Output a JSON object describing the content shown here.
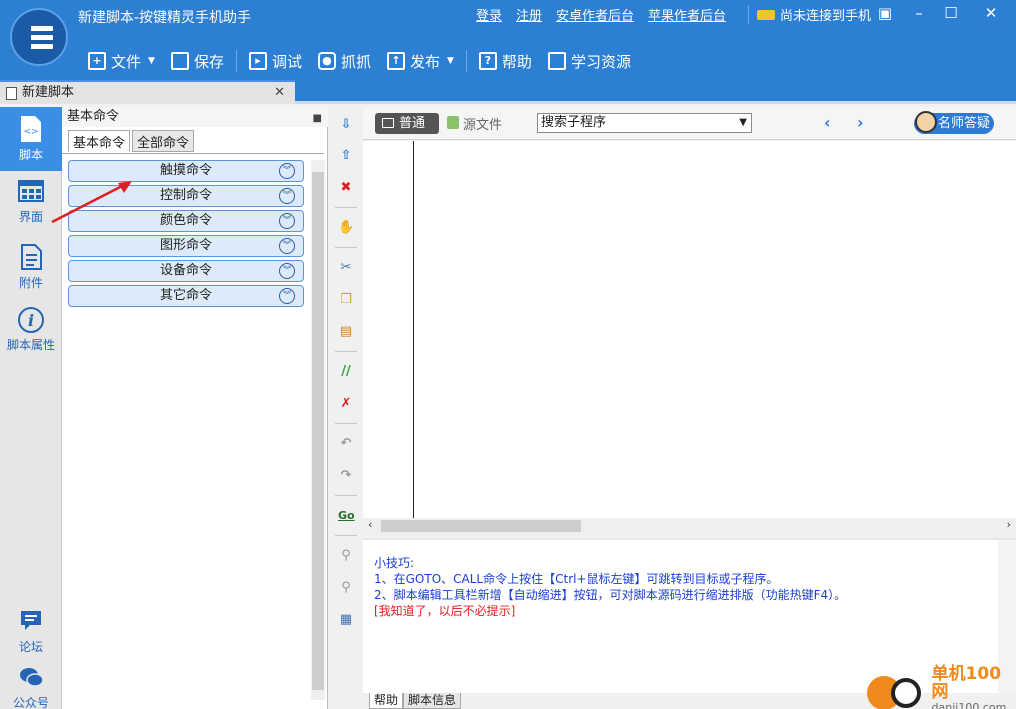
{
  "window": {
    "title": "新建脚本-按键精灵手机助手",
    "links": [
      "登录",
      "注册",
      "安卓作者后台",
      "苹果作者后台"
    ],
    "connection_status": "尚未连接到手机"
  },
  "toolbar": {
    "file": "文件",
    "save": "保存",
    "debug": "调试",
    "capture": "抓抓",
    "publish": "发布",
    "help": "帮助",
    "learn": "学习资源"
  },
  "doc_tab": {
    "label": "新建脚本"
  },
  "left_nav": {
    "script": "脚本",
    "ui": "界面",
    "attachment": "附件",
    "properties": "脚本属性",
    "forum": "论坛",
    "official": "公众号"
  },
  "command_panel": {
    "header": "基本命令",
    "tabs": [
      "基本命令",
      "全部命令"
    ],
    "commands": [
      "触摸命令",
      "控制命令",
      "颜色命令",
      "图形命令",
      "设备命令",
      "其它命令"
    ]
  },
  "editor": {
    "mode_normal": "普通",
    "mode_source": "源文件",
    "search_placeholder": "搜索子程序",
    "expert_button": "名师答疑"
  },
  "tips": {
    "title": "小技巧:",
    "line1": "1、在GOTO、CALL命令上按住【Ctrl+鼠标左键】可跳转到目标或子程序。",
    "line2": "2、脚本编辑工具栏新增【自动缩进】按钮，可对脚本源码进行缩进排版（功能热键F4）。",
    "dismiss": "[我知道了，以后不必提示]"
  },
  "bottom_tabs": [
    "帮助",
    "脚本信息"
  ],
  "watermark": {
    "name": "单机100网",
    "url": "danji100.com"
  }
}
